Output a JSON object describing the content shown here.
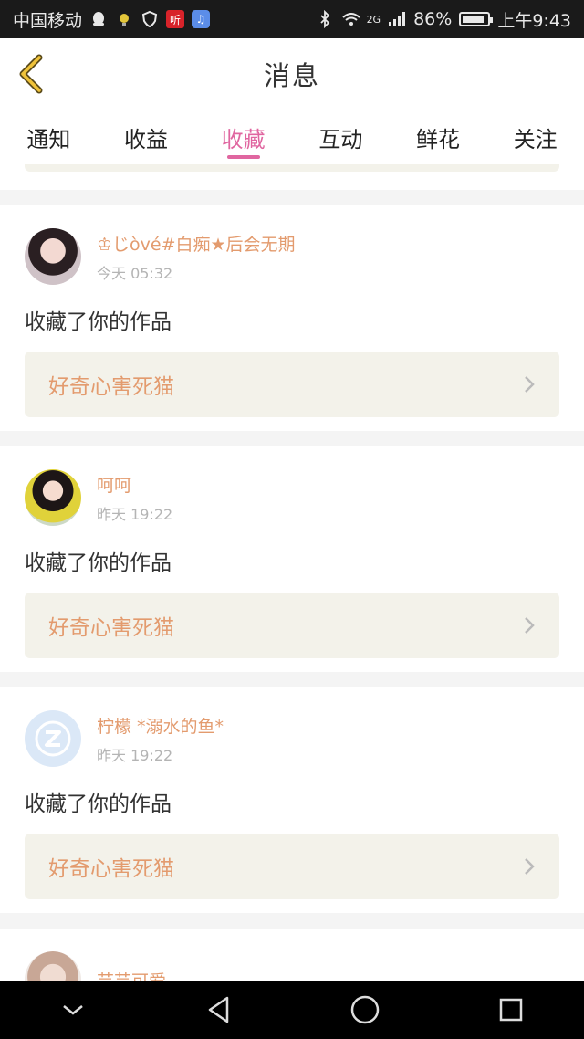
{
  "status_bar": {
    "carrier": "中国移动",
    "app_badge_1": "听",
    "app_badge_2": "♫",
    "network": "2G",
    "battery": "86%",
    "battery_level": 0.86,
    "time": "上午9:43"
  },
  "header": {
    "title": "消息"
  },
  "tabs": [
    {
      "label": "通知",
      "active": false
    },
    {
      "label": "收益",
      "active": false
    },
    {
      "label": "收藏",
      "active": true
    },
    {
      "label": "互动",
      "active": false
    },
    {
      "label": "鲜花",
      "active": false
    },
    {
      "label": "关注",
      "active": false
    }
  ],
  "messages": [
    {
      "username": "♔じòvé#白痴★后会无期",
      "time": "今天 05:32",
      "action": "收藏了你的作品",
      "work_title": "好奇心害死猫"
    },
    {
      "username": "呵呵",
      "time": "昨天 19:22",
      "action": "收藏了你的作品",
      "work_title": "好奇心害死猫"
    },
    {
      "username": "柠檬 *溺水的鱼*",
      "time": "昨天 19:22",
      "action": "收藏了你的作品",
      "work_title": "好奇心害死猫"
    },
    {
      "username": "芸芸可爱"
    }
  ],
  "colors": {
    "accent": "#e066a0",
    "username": "#e39b6e",
    "link_bg": "#f3f2ea"
  }
}
